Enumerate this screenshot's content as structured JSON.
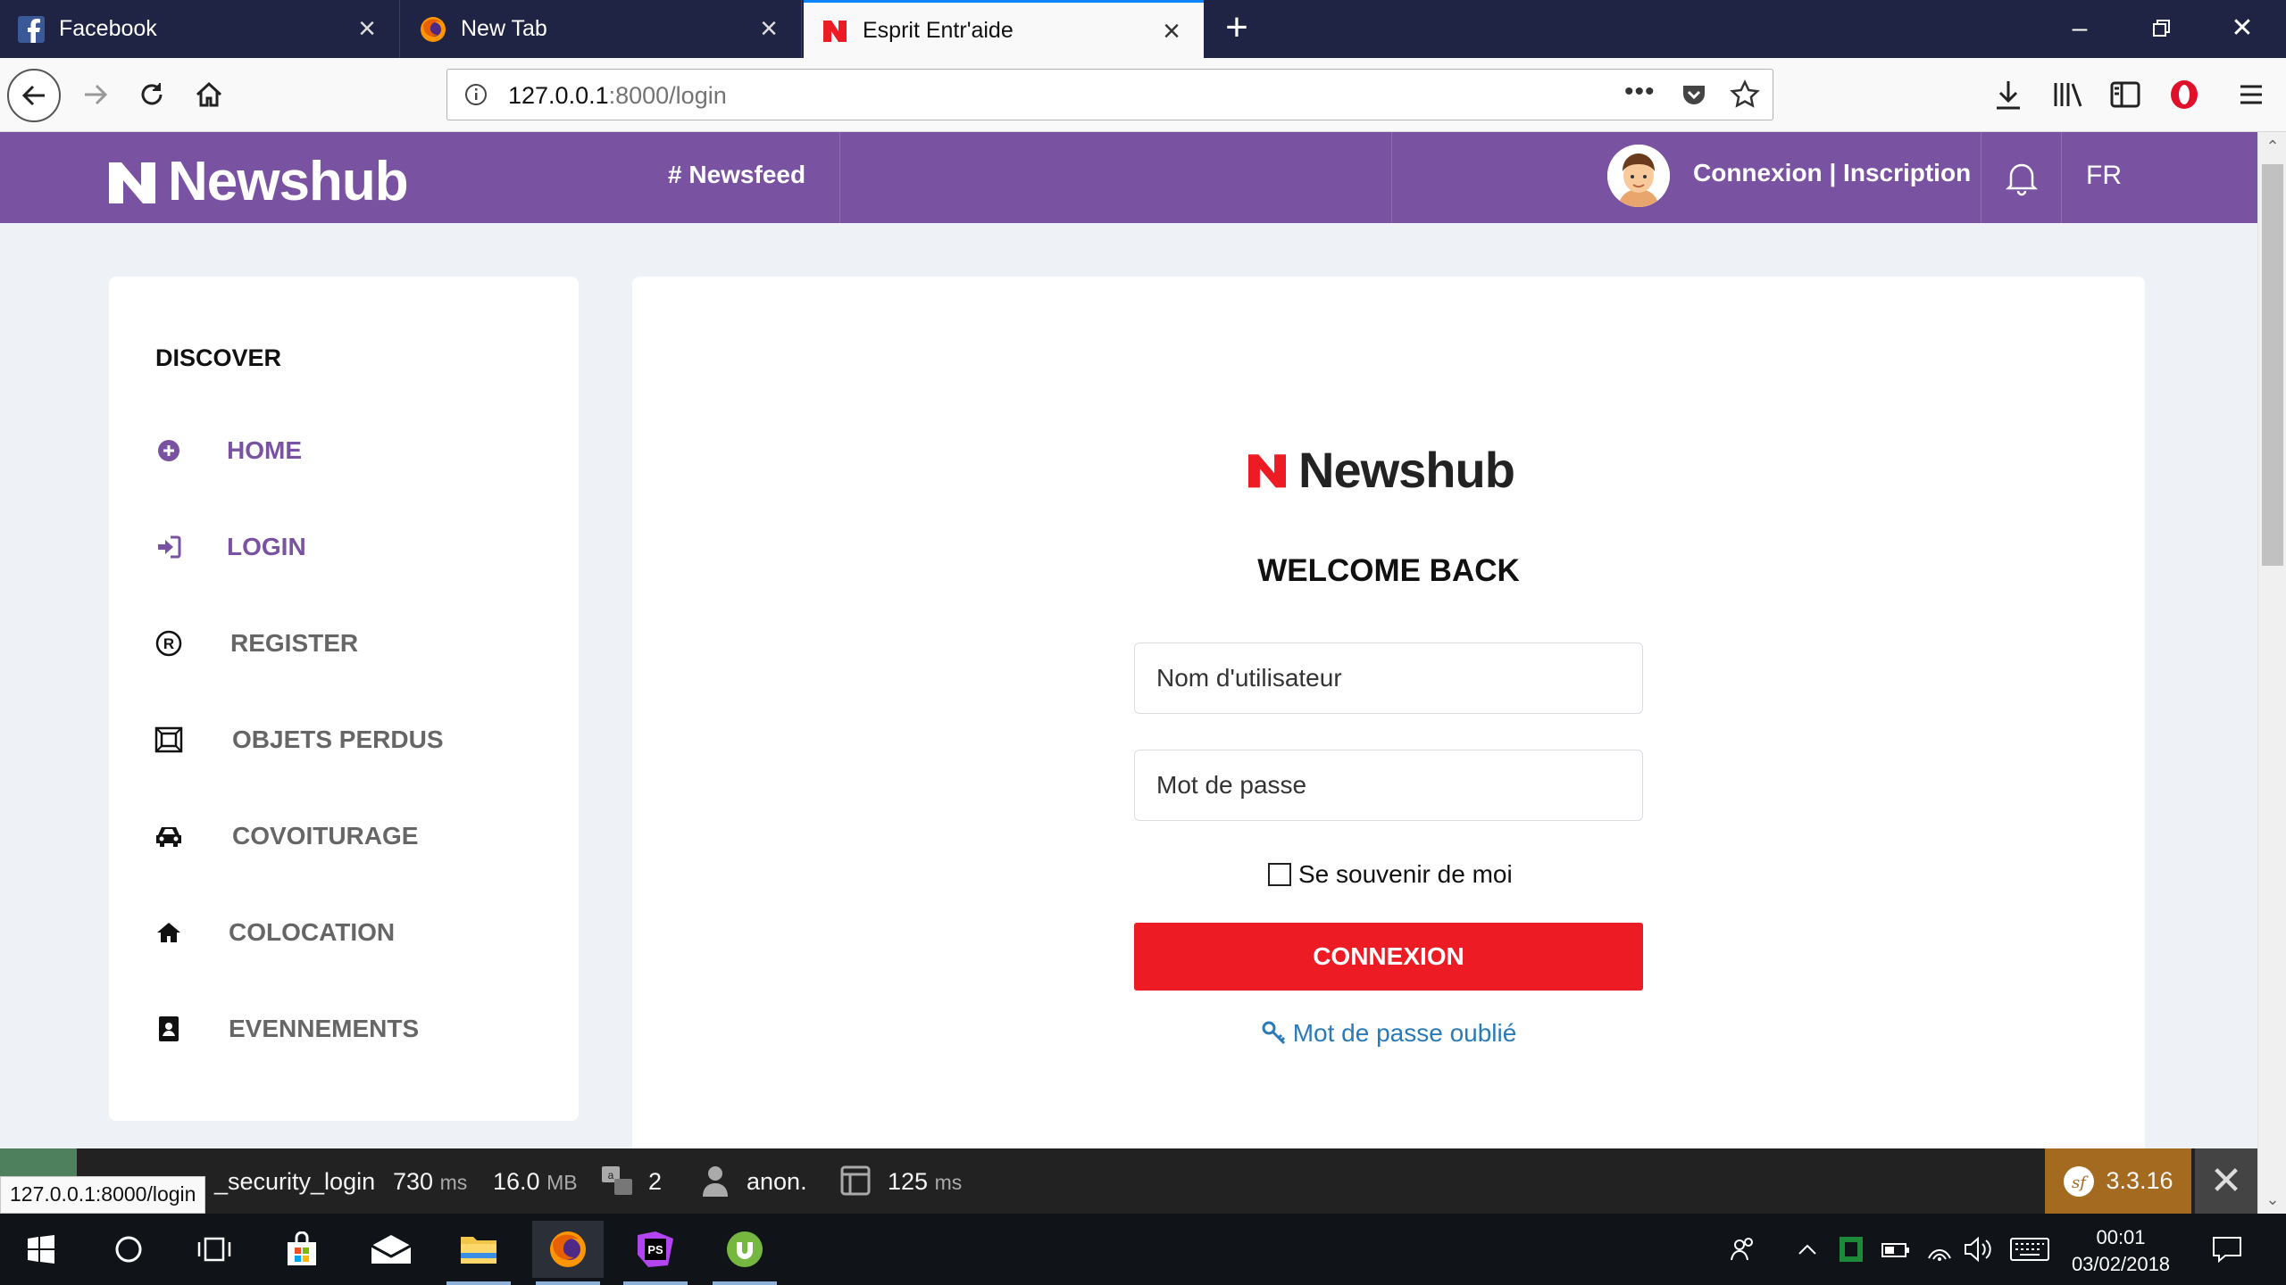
{
  "browser": {
    "tabs": [
      {
        "label": "Facebook"
      },
      {
        "label": "New Tab"
      },
      {
        "label": "Esprit Entr'aide"
      }
    ],
    "url_host": "127.0.0.1",
    "url_path": ":8000/login",
    "status_url": "127.0.0.1:8000/login"
  },
  "site": {
    "logo_text": "Newshub",
    "newsfeed_label": "# Newsfeed",
    "auth_label": "Connexion | Inscription",
    "lang_label": "FR",
    "brand_color": "#7953a2",
    "accent_red": "#ed1c24"
  },
  "sidebar": {
    "heading": "DISCOVER",
    "items": [
      {
        "label": "HOME",
        "icon": "plus-circle-icon"
      },
      {
        "label": "LOGIN",
        "icon": "sign-in-icon"
      },
      {
        "label": "REGISTER",
        "icon": "registered-icon"
      },
      {
        "label": "OBJETS PERDUS",
        "icon": "frame-icon"
      },
      {
        "label": "COVOITURAGE",
        "icon": "car-icon"
      },
      {
        "label": "COLOCATION",
        "icon": "home-icon"
      },
      {
        "label": "EVENNEMENTS",
        "icon": "address-book-icon"
      }
    ]
  },
  "login": {
    "logo_text": "Newshub",
    "title": "WELCOME BACK",
    "username_placeholder": "Nom d'utilisateur",
    "password_placeholder": "Mot de passe",
    "remember_label": "Se souvenir de moi",
    "submit_label": "CONNEXION",
    "forgot_label": "Mot de passe oublié"
  },
  "symfony_toolbar": {
    "route": "_security_login",
    "time_value": "730",
    "time_unit": "ms",
    "memory_value": "16.0",
    "memory_unit": "MB",
    "translations_count": "2",
    "user": "anon.",
    "twig_value": "125",
    "twig_unit": "ms",
    "version": "3.3.16"
  },
  "taskbar": {
    "time": "00:01",
    "date": "03/02/2018"
  }
}
